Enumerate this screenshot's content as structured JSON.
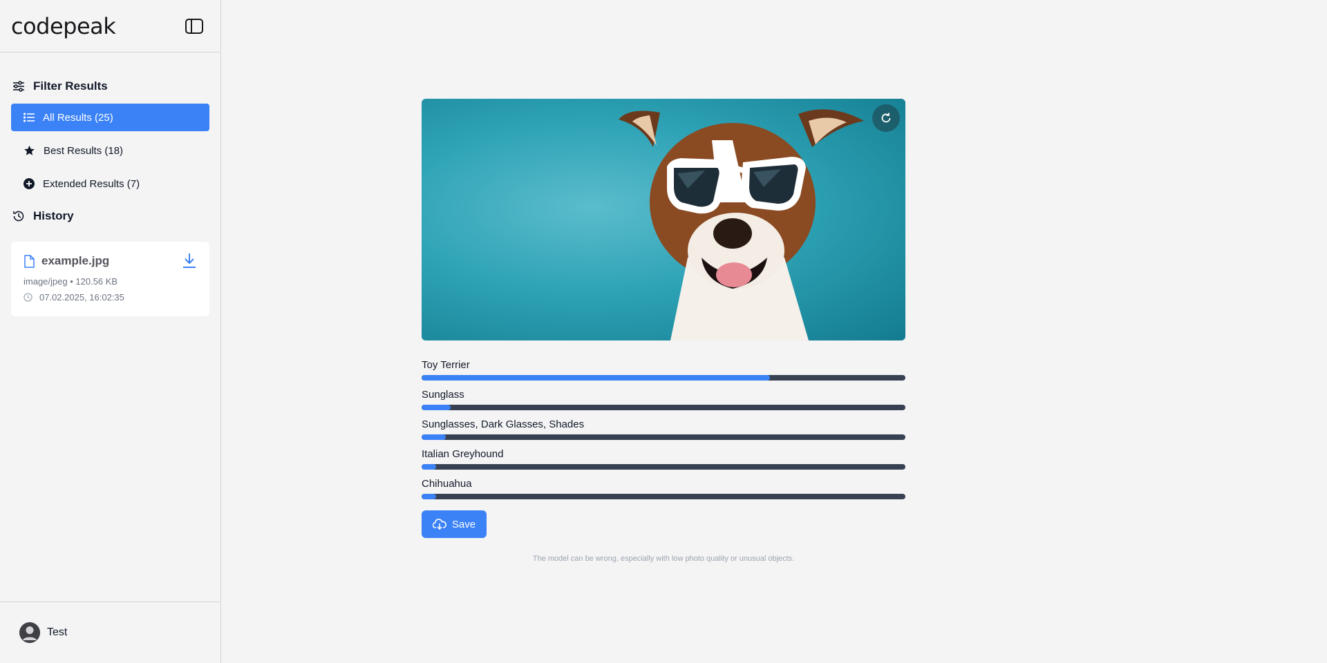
{
  "sidebar": {
    "brand": "codepeak",
    "filter_heading": "Filter Results",
    "items": [
      {
        "label": "All Results (25)",
        "icon": "list-icon",
        "active": true
      },
      {
        "label": "Best Results (18)",
        "icon": "star-icon",
        "active": false
      },
      {
        "label": "Extended Results (7)",
        "icon": "plus-circle-icon",
        "active": false
      }
    ],
    "history_heading": "History",
    "history": [
      {
        "file_name": "example.jpg",
        "meta": "image/jpeg • 120.56 KB",
        "timestamp": "07.02.2025, 16:02:35"
      }
    ],
    "user": {
      "name": "Test"
    }
  },
  "main": {
    "image": {
      "subject": "dog-with-sunglasses",
      "background_color": "#2ea3b6"
    },
    "results": [
      {
        "label": "Toy Terrier",
        "percent": 72
      },
      {
        "label": "Sunglass",
        "percent": 6
      },
      {
        "label": "Sunglasses, Dark Glasses, Shades",
        "percent": 5
      },
      {
        "label": "Italian Greyhound",
        "percent": 3
      },
      {
        "label": "Chihuahua",
        "percent": 3
      }
    ],
    "save_label": "Save",
    "disclaimer": "The model can be wrong, especially with low photo quality or unusual objects."
  },
  "colors": {
    "accent": "#3b82f6",
    "bar_track": "#374151",
    "background": "#f4f4f5"
  }
}
